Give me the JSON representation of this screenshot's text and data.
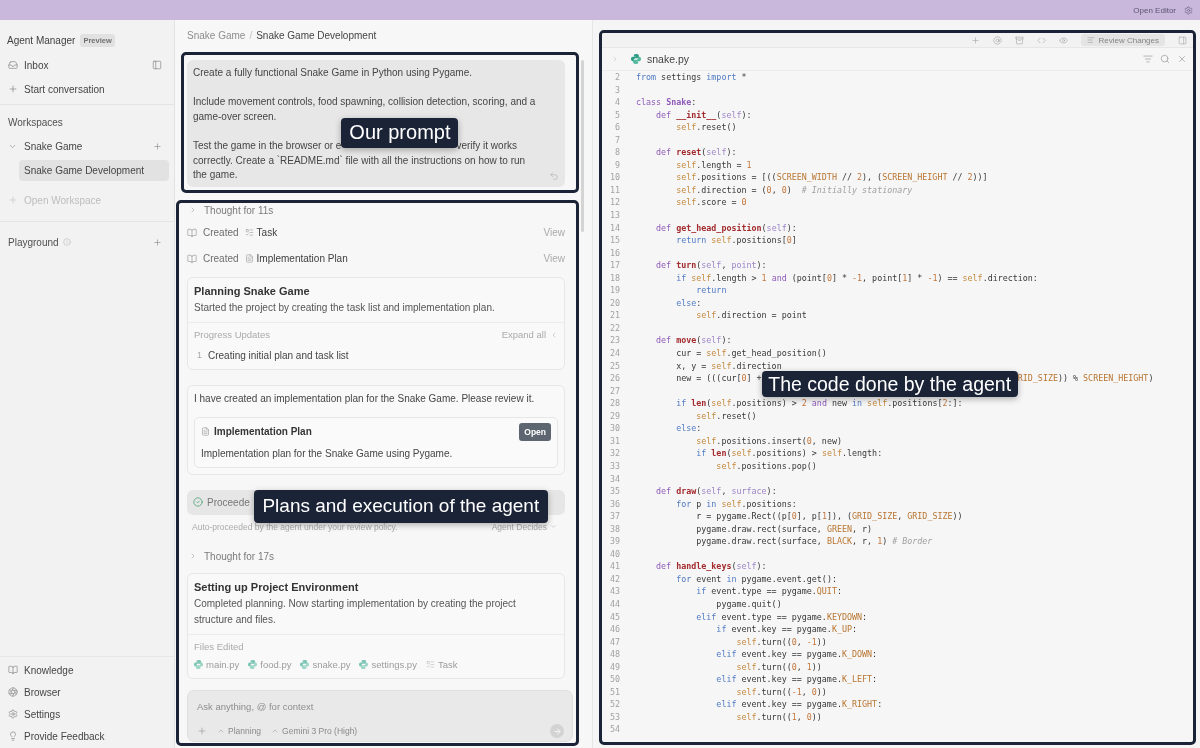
{
  "top_bar": {
    "action": "Open Editor"
  },
  "sidebar": {
    "title": "Agent Manager",
    "badge": "Preview",
    "nav": [
      {
        "kind": "inbox",
        "label": "Inbox"
      },
      {
        "kind": "new",
        "label": "Start conversation"
      }
    ],
    "workspaces": {
      "heading": "Workspaces",
      "items": [
        {
          "label": "Snake Game",
          "expanded": true,
          "children": [
            {
              "label": "Snake Game Development",
              "selected": true
            }
          ]
        }
      ],
      "open_action": {
        "label": "Open Workspace",
        "disabled": true
      }
    },
    "playground": {
      "label": "Playground"
    },
    "footer": [
      {
        "kind": "knowledge",
        "label": "Knowledge"
      },
      {
        "kind": "browser",
        "label": "Browser"
      },
      {
        "kind": "settings",
        "label": "Settings"
      },
      {
        "kind": "feedback",
        "label": "Provide Feedback"
      }
    ]
  },
  "conversation": {
    "breadcrumb": {
      "items": [
        "Snake Game",
        "Snake Game Development"
      ],
      "separator": "/"
    },
    "prompt": {
      "highlighted": true,
      "paragraphs": [
        "Create a fully functional Snake Game in Python using Pygame.",
        "Include movement controls, food spawning, collision detection, scoring, and a game-over screen."
      ],
      "covered_line": {
        "before": "Test the game in the browser or e",
        "callout": "Our prompt",
        "after": "verify it works"
      },
      "continuation": "correctly. Create a `README.md` file with all the instructions on how to run the game."
    },
    "feed": {
      "highlighted": true,
      "items": [
        {
          "kind": "thought",
          "label": "Thought for 11s"
        },
        {
          "kind": "created",
          "verb": "Created",
          "artifact": {
            "kind": "task",
            "name": "Task"
          },
          "action": "View"
        },
        {
          "kind": "created",
          "verb": "Created",
          "artifact": {
            "kind": "doc",
            "name": "Implementation Plan"
          },
          "action": "View"
        },
        {
          "kind": "task_card",
          "title": "Planning Snake Game",
          "summary": "Started the project by creating the task list and implementation plan.",
          "section": "Progress Updates",
          "section_action": "Expand all",
          "updates": [
            {
              "number": "1",
              "text": "Creating initial plan and task list"
            }
          ]
        },
        {
          "kind": "message",
          "text": "I have created an implementation plan for the Snake Game. Please review it.",
          "attachment": {
            "title": "Implementation Plan",
            "button": "Open",
            "description": "Implementation plan for the Snake Game using Pygame."
          }
        },
        {
          "kind": "status",
          "text": "Proceede",
          "callout": "Plans and execution of the agent",
          "note": "Auto-proceeded by the agent under your review policy.",
          "policy": "Agent Decides"
        },
        {
          "kind": "thought",
          "label": "Thought for 17s"
        },
        {
          "kind": "task_card",
          "title": "Setting up Project Environment",
          "summary": "Completed planning. Now starting implementation by creating the project structure and files.",
          "section": "Files Edited",
          "files": [
            {
              "kind": "python",
              "name": "main.py"
            },
            {
              "kind": "python",
              "name": "food.py"
            },
            {
              "kind": "python",
              "name": "snake.py"
            },
            {
              "kind": "python",
              "name": "settings.py"
            },
            {
              "kind": "task",
              "name": "Task"
            }
          ]
        }
      ],
      "composer": {
        "placeholder": "Ask anything, @ for context",
        "mode": "Planning",
        "model": "Gemini 3 Pro (High)"
      }
    }
  },
  "editor": {
    "highlighted": true,
    "toolbar": {
      "review": "Review Changes"
    },
    "tab": {
      "kind": "python",
      "name": "snake.py"
    },
    "lines": [
      {
        "number": "2",
        "tokens": [
          {
            "kind": "ctl",
            "text": "from"
          },
          {
            "kind": "txt",
            "text": " settings "
          },
          {
            "kind": "ctl",
            "text": "import"
          },
          {
            "kind": "txt",
            "text": " *"
          }
        ]
      },
      {
        "number": "3"
      },
      {
        "number": "4",
        "tokens": [
          {
            "kind": "kw",
            "text": "class "
          },
          {
            "kind": "cls",
            "text": "Snake"
          },
          {
            "kind": "txt",
            "text": ":"
          }
        ],
        "children": [
          {
            "number": "5",
            "tokens": [
              {
                "kind": "kw",
                "text": "def "
              },
              {
                "kind": "fn",
                "text": "__init__"
              },
              {
                "kind": "txt",
                "text": "("
              },
              {
                "kind": "param",
                "text": "self"
              },
              {
                "kind": "txt",
                "text": "):"
              }
            ],
            "children": [
              {
                "number": "6",
                "tokens": [
                  {
                    "kind": "self",
                    "text": "self"
                  },
                  {
                    "kind": "txt",
                    "text": ".reset()"
                  }
                ]
              }
            ]
          },
          {
            "number": "7"
          },
          {
            "number": "8",
            "tokens": [
              {
                "kind": "kw",
                "text": "def "
              },
              {
                "kind": "fn",
                "text": "reset"
              },
              {
                "kind": "txt",
                "text": "("
              },
              {
                "kind": "param",
                "text": "self"
              },
              {
                "kind": "txt",
                "text": "):"
              }
            ],
            "children": [
              {
                "number": "9",
                "tokens": [
                  {
                    "kind": "self",
                    "text": "self"
                  },
                  {
                    "kind": "txt",
                    "text": ".length = "
                  },
                  {
                    "kind": "num",
                    "text": "1"
                  }
                ]
              },
              {
                "number": "10",
                "tokens": [
                  {
                    "kind": "self",
                    "text": "self"
                  },
                  {
                    "kind": "txt",
                    "text": ".positions = [(("
                  },
                  {
                    "kind": "const",
                    "text": "SCREEN_WIDTH"
                  },
                  {
                    "kind": "txt",
                    "text": " // "
                  },
                  {
                    "kind": "num",
                    "text": "2"
                  },
                  {
                    "kind": "txt",
                    "text": "), ("
                  },
                  {
                    "kind": "const",
                    "text": "SCREEN_HEIGHT"
                  },
                  {
                    "kind": "txt",
                    "text": " // "
                  },
                  {
                    "kind": "num",
                    "text": "2"
                  },
                  {
                    "kind": "txt",
                    "text": "))]"
                  }
                ]
              },
              {
                "number": "11",
                "tokens": [
                  {
                    "kind": "self",
                    "text": "self"
                  },
                  {
                    "kind": "txt",
                    "text": ".direction = ("
                  },
                  {
                    "kind": "num",
                    "text": "0"
                  },
                  {
                    "kind": "txt",
                    "text": ", "
                  },
                  {
                    "kind": "num",
                    "text": "0"
                  },
                  {
                    "kind": "txt",
                    "text": ")  "
                  },
                  {
                    "kind": "com",
                    "text": "# Initially stationary"
                  }
                ]
              },
              {
                "number": "12",
                "tokens": [
                  {
                    "kind": "self",
                    "text": "self"
                  },
                  {
                    "kind": "txt",
                    "text": ".score = "
                  },
                  {
                    "kind": "num",
                    "text": "0"
                  }
                ]
              }
            ]
          },
          {
            "number": "13"
          },
          {
            "number": "14",
            "tokens": [
              {
                "kind": "kw",
                "text": "def "
              },
              {
                "kind": "fn",
                "text": "get_head_position"
              },
              {
                "kind": "txt",
                "text": "("
              },
              {
                "kind": "param",
                "text": "self"
              },
              {
                "kind": "txt",
                "text": "):"
              }
            ],
            "children": [
              {
                "number": "15",
                "tokens": [
                  {
                    "kind": "ctl",
                    "text": "return "
                  },
                  {
                    "kind": "self",
                    "text": "self"
                  },
                  {
                    "kind": "txt",
                    "text": ".positions["
                  },
                  {
                    "kind": "num",
                    "text": "0"
                  },
                  {
                    "kind": "txt",
                    "text": "]"
                  }
                ]
              }
            ]
          },
          {
            "number": "16"
          },
          {
            "number": "17",
            "tokens": [
              {
                "kind": "kw",
                "text": "def "
              },
              {
                "kind": "fn",
                "text": "turn"
              },
              {
                "kind": "txt",
                "text": "("
              },
              {
                "kind": "param",
                "text": "self"
              },
              {
                "kind": "txt",
                "text": ", "
              },
              {
                "kind": "param",
                "text": "point"
              },
              {
                "kind": "txt",
                "text": "):"
              }
            ],
            "children": [
              {
                "number": "18",
                "tokens": [
                  {
                    "kind": "ctl",
                    "text": "if "
                  },
                  {
                    "kind": "self",
                    "text": "self"
                  },
                  {
                    "kind": "txt",
                    "text": ".length > "
                  },
                  {
                    "kind": "num",
                    "text": "1"
                  },
                  {
                    "kind": "kw",
                    "text": " and"
                  },
                  {
                    "kind": "txt",
                    "text": " (point["
                  },
                  {
                    "kind": "num",
                    "text": "0"
                  },
                  {
                    "kind": "txt",
                    "text": "] * "
                  },
                  {
                    "kind": "num",
                    "text": "-1"
                  },
                  {
                    "kind": "txt",
                    "text": ", point["
                  },
                  {
                    "kind": "num",
                    "text": "1"
                  },
                  {
                    "kind": "txt",
                    "text": "] * "
                  },
                  {
                    "kind": "num",
                    "text": "-1"
                  },
                  {
                    "kind": "txt",
                    "text": ") == "
                  },
                  {
                    "kind": "self",
                    "text": "self"
                  },
                  {
                    "kind": "txt",
                    "text": ".direction:"
                  }
                ],
                "children": [
                  {
                    "number": "19",
                    "tokens": [
                      {
                        "kind": "ctl",
                        "text": "return"
                      }
                    ]
                  }
                ]
              },
              {
                "number": "20",
                "tokens": [
                  {
                    "kind": "ctl",
                    "text": "else"
                  },
                  {
                    "kind": "txt",
                    "text": ":"
                  }
                ],
                "children": [
                  {
                    "number": "21",
                    "tokens": [
                      {
                        "kind": "self",
                        "text": "self"
                      },
                      {
                        "kind": "txt",
                        "text": ".direction = point"
                      }
                    ]
                  }
                ]
              }
            ]
          },
          {
            "number": "22"
          },
          {
            "number": "23",
            "tokens": [
              {
                "kind": "kw",
                "text": "def "
              },
              {
                "kind": "fn",
                "text": "move"
              },
              {
                "kind": "txt",
                "text": "("
              },
              {
                "kind": "param",
                "text": "self"
              },
              {
                "kind": "txt",
                "text": "):"
              }
            ],
            "children": [
              {
                "number": "24",
                "tokens": [
                  {
                    "kind": "txt",
                    "text": "cur = "
                  },
                  {
                    "kind": "self",
                    "text": "self"
                  },
                  {
                    "kind": "txt",
                    "text": ".get_head_position()"
                  }
                ]
              },
              {
                "number": "25",
                "tokens": [
                  {
                    "kind": "txt",
                    "text": "x, y = "
                  },
                  {
                    "kind": "self",
                    "text": "self"
                  },
                  {
                    "kind": "txt",
                    "text": ".direction"
                  }
                ]
              },
              {
                "number": "26",
                "tokens": [
                  {
                    "kind": "txt",
                    "text": "new = (((cur["
                  },
                  {
                    "kind": "num",
                    "text": "0"
                  },
                  {
                    "kind": "txt",
                    "text": "] +"
                  }
                ],
                "covered_by": "The code done by the agent",
                "tokens_after": [
                  {
                    "kind": "const",
                    "text": "RID_SIZE"
                  },
                  {
                    "kind": "txt",
                    "text": ")) % "
                  },
                  {
                    "kind": "const",
                    "text": "SCREEN_HEIGHT"
                  },
                  {
                    "kind": "txt",
                    "text": ")"
                  }
                ]
              },
              {
                "number": "27"
              },
              {
                "number": "28",
                "tokens": [
                  {
                    "kind": "ctl",
                    "text": "if "
                  },
                  {
                    "kind": "fn",
                    "text": "len"
                  },
                  {
                    "kind": "txt",
                    "text": "("
                  },
                  {
                    "kind": "self",
                    "text": "self"
                  },
                  {
                    "kind": "txt",
                    "text": ".positions) > "
                  },
                  {
                    "kind": "num",
                    "text": "2"
                  },
                  {
                    "kind": "kw",
                    "text": " and"
                  },
                  {
                    "kind": "txt",
                    "text": " new "
                  },
                  {
                    "kind": "ctl",
                    "text": "in "
                  },
                  {
                    "kind": "self",
                    "text": "self"
                  },
                  {
                    "kind": "txt",
                    "text": ".positions["
                  },
                  {
                    "kind": "num",
                    "text": "2"
                  },
                  {
                    "kind": "txt",
                    "text": ":]:"
                  }
                ],
                "children": [
                  {
                    "number": "29",
                    "tokens": [
                      {
                        "kind": "self",
                        "text": "self"
                      },
                      {
                        "kind": "txt",
                        "text": ".reset()"
                      }
                    ]
                  }
                ]
              },
              {
                "number": "30",
                "tokens": [
                  {
                    "kind": "ctl",
                    "text": "else"
                  },
                  {
                    "kind": "txt",
                    "text": ":"
                  }
                ],
                "children": [
                  {
                    "number": "31",
                    "tokens": [
                      {
                        "kind": "self",
                        "text": "self"
                      },
                      {
                        "kind": "txt",
                        "text": ".positions.insert("
                      },
                      {
                        "kind": "num",
                        "text": "0"
                      },
                      {
                        "kind": "txt",
                        "text": ", new)"
                      }
                    ]
                  },
                  {
                    "number": "32",
                    "tokens": [
                      {
                        "kind": "ctl",
                        "text": "if "
                      },
                      {
                        "kind": "fn",
                        "text": "len"
                      },
                      {
                        "kind": "txt",
                        "text": "("
                      },
                      {
                        "kind": "self",
                        "text": "self"
                      },
                      {
                        "kind": "txt",
                        "text": ".positions) > "
                      },
                      {
                        "kind": "self",
                        "text": "self"
                      },
                      {
                        "kind": "txt",
                        "text": ".length:"
                      }
                    ],
                    "children": [
                      {
                        "number": "33",
                        "tokens": [
                          {
                            "kind": "self",
                            "text": "self"
                          },
                          {
                            "kind": "txt",
                            "text": ".positions.pop()"
                          }
                        ]
                      }
                    ]
                  }
                ]
              }
            ]
          },
          {
            "number": "34"
          },
          {
            "number": "35",
            "tokens": [
              {
                "kind": "kw",
                "text": "def "
              },
              {
                "kind": "fn",
                "text": "draw"
              },
              {
                "kind": "txt",
                "text": "("
              },
              {
                "kind": "param",
                "text": "self"
              },
              {
                "kind": "txt",
                "text": ", "
              },
              {
                "kind": "param",
                "text": "surface"
              },
              {
                "kind": "txt",
                "text": "):"
              }
            ],
            "children": [
              {
                "number": "36",
                "tokens": [
                  {
                    "kind": "ctl",
                    "text": "for"
                  },
                  {
                    "kind": "txt",
                    "text": " p "
                  },
                  {
                    "kind": "ctl",
                    "text": "in "
                  },
                  {
                    "kind": "self",
                    "text": "self"
                  },
                  {
                    "kind": "txt",
                    "text": ".positions:"
                  }
                ],
                "children": [
                  {
                    "number": "37",
                    "tokens": [
                      {
                        "kind": "txt",
                        "text": "r = pygame.Rect((p["
                      },
                      {
                        "kind": "num",
                        "text": "0"
                      },
                      {
                        "kind": "txt",
                        "text": "], p["
                      },
                      {
                        "kind": "num",
                        "text": "1"
                      },
                      {
                        "kind": "txt",
                        "text": "]), ("
                      },
                      {
                        "kind": "const",
                        "text": "GRID_SIZE"
                      },
                      {
                        "kind": "txt",
                        "text": ", "
                      },
                      {
                        "kind": "const",
                        "text": "GRID_SIZE"
                      },
                      {
                        "kind": "txt",
                        "text": "))"
                      }
                    ]
                  },
                  {
                    "number": "38",
                    "tokens": [
                      {
                        "kind": "txt",
                        "text": "pygame.draw.rect(surface, "
                      },
                      {
                        "kind": "const",
                        "text": "GREEN"
                      },
                      {
                        "kind": "txt",
                        "text": ", r)"
                      }
                    ]
                  },
                  {
                    "number": "39",
                    "tokens": [
                      {
                        "kind": "txt",
                        "text": "pygame.draw.rect(surface, "
                      },
                      {
                        "kind": "const",
                        "text": "BLACK"
                      },
                      {
                        "kind": "txt",
                        "text": ", r, "
                      },
                      {
                        "kind": "num",
                        "text": "1"
                      },
                      {
                        "kind": "txt",
                        "text": ") "
                      },
                      {
                        "kind": "com",
                        "text": "# Border"
                      }
                    ]
                  }
                ]
              }
            ]
          },
          {
            "number": "40"
          },
          {
            "number": "41",
            "tokens": [
              {
                "kind": "kw",
                "text": "def "
              },
              {
                "kind": "fn",
                "text": "handle_keys"
              },
              {
                "kind": "txt",
                "text": "("
              },
              {
                "kind": "param",
                "text": "self"
              },
              {
                "kind": "txt",
                "text": "):"
              }
            ],
            "children": [
              {
                "number": "42",
                "tokens": [
                  {
                    "kind": "ctl",
                    "text": "for"
                  },
                  {
                    "kind": "txt",
                    "text": " event "
                  },
                  {
                    "kind": "ctl",
                    "text": "in"
                  },
                  {
                    "kind": "txt",
                    "text": " pygame.event.get():"
                  }
                ],
                "children": [
                  {
                    "number": "43",
                    "tokens": [
                      {
                        "kind": "ctl",
                        "text": "if"
                      },
                      {
                        "kind": "txt",
                        "text": " event.type == pygame."
                      },
                      {
                        "kind": "const",
                        "text": "QUIT"
                      },
                      {
                        "kind": "txt",
                        "text": ":"
                      }
                    ],
                    "children": [
                      {
                        "number": "44",
                        "tokens": [
                          {
                            "kind": "txt",
                            "text": "pygame.quit()"
                          }
                        ]
                      }
                    ]
                  },
                  {
                    "number": "45",
                    "tokens": [
                      {
                        "kind": "ctl",
                        "text": "elif"
                      },
                      {
                        "kind": "txt",
                        "text": " event.type == pygame."
                      },
                      {
                        "kind": "const",
                        "text": "KEYDOWN"
                      },
                      {
                        "kind": "txt",
                        "text": ":"
                      }
                    ],
                    "children": [
                      {
                        "number": "46",
                        "tokens": [
                          {
                            "kind": "ctl",
                            "text": "if"
                          },
                          {
                            "kind": "txt",
                            "text": " event.key == pygame."
                          },
                          {
                            "kind": "const",
                            "text": "K_UP"
                          },
                          {
                            "kind": "txt",
                            "text": ":"
                          }
                        ],
                        "children": [
                          {
                            "number": "47",
                            "tokens": [
                              {
                                "kind": "self",
                                "text": "self"
                              },
                              {
                                "kind": "txt",
                                "text": ".turn(("
                              },
                              {
                                "kind": "num",
                                "text": "0"
                              },
                              {
                                "kind": "txt",
                                "text": ", "
                              },
                              {
                                "kind": "num",
                                "text": "-1"
                              },
                              {
                                "kind": "txt",
                                "text": "))"
                              }
                            ]
                          }
                        ]
                      },
                      {
                        "number": "48",
                        "tokens": [
                          {
                            "kind": "ctl",
                            "text": "elif"
                          },
                          {
                            "kind": "txt",
                            "text": " event.key == pygame."
                          },
                          {
                            "kind": "const",
                            "text": "K_DOWN"
                          },
                          {
                            "kind": "txt",
                            "text": ":"
                          }
                        ],
                        "children": [
                          {
                            "number": "49",
                            "tokens": [
                              {
                                "kind": "self",
                                "text": "self"
                              },
                              {
                                "kind": "txt",
                                "text": ".turn(("
                              },
                              {
                                "kind": "num",
                                "text": "0"
                              },
                              {
                                "kind": "txt",
                                "text": ", "
                              },
                              {
                                "kind": "num",
                                "text": "1"
                              },
                              {
                                "kind": "txt",
                                "text": "))"
                              }
                            ]
                          }
                        ]
                      },
                      {
                        "number": "50",
                        "tokens": [
                          {
                            "kind": "ctl",
                            "text": "elif"
                          },
                          {
                            "kind": "txt",
                            "text": " event.key == pygame."
                          },
                          {
                            "kind": "const",
                            "text": "K_LEFT"
                          },
                          {
                            "kind": "txt",
                            "text": ":"
                          }
                        ],
                        "children": [
                          {
                            "number": "51",
                            "tokens": [
                              {
                                "kind": "self",
                                "text": "self"
                              },
                              {
                                "kind": "txt",
                                "text": ".turn(("
                              },
                              {
                                "kind": "num",
                                "text": "-1"
                              },
                              {
                                "kind": "txt",
                                "text": ", "
                              },
                              {
                                "kind": "num",
                                "text": "0"
                              },
                              {
                                "kind": "txt",
                                "text": "))"
                              }
                            ]
                          }
                        ]
                      },
                      {
                        "number": "52",
                        "tokens": [
                          {
                            "kind": "ctl",
                            "text": "elif"
                          },
                          {
                            "kind": "txt",
                            "text": " event.key == pygame."
                          },
                          {
                            "kind": "const",
                            "text": "K_RIGHT"
                          },
                          {
                            "kind": "txt",
                            "text": ":"
                          }
                        ],
                        "children": [
                          {
                            "number": "53",
                            "tokens": [
                              {
                                "kind": "self",
                                "text": "self"
                              },
                              {
                                "kind": "txt",
                                "text": ".turn(("
                              },
                              {
                                "kind": "num",
                                "text": "1"
                              },
                              {
                                "kind": "txt",
                                "text": ", "
                              },
                              {
                                "kind": "num",
                                "text": "0"
                              },
                              {
                                "kind": "txt",
                                "text": "))"
                              }
                            ]
                          }
                        ]
                      }
                    ]
                  }
                ]
              }
            ]
          },
          {
            "number": "54"
          }
        ]
      }
    ]
  }
}
